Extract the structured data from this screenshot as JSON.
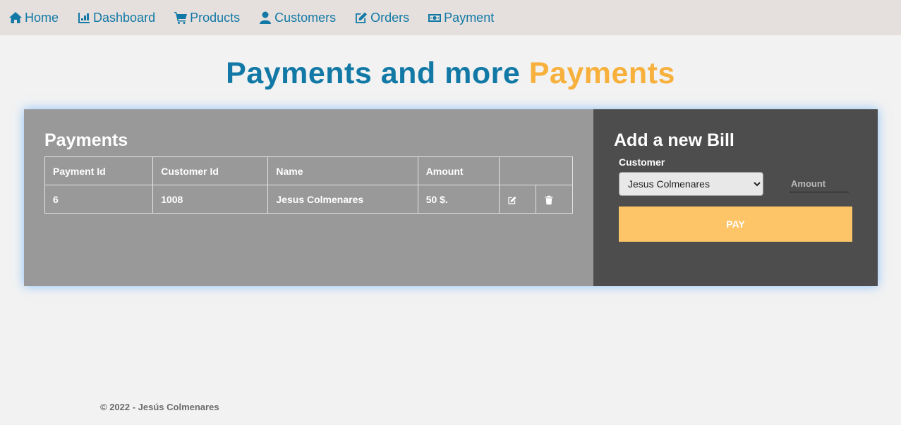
{
  "nav": {
    "items": [
      {
        "label": "Home",
        "icon": "home-icon"
      },
      {
        "label": "Dashboard",
        "icon": "chart-icon"
      },
      {
        "label": "Products",
        "icon": "cart-icon"
      },
      {
        "label": "Customers",
        "icon": "user-icon"
      },
      {
        "label": "Orders",
        "icon": "edit-icon"
      },
      {
        "label": "Payment",
        "icon": "money-icon"
      }
    ]
  },
  "page_title": {
    "part1": "Payments and more",
    "part2": "Payments"
  },
  "payments": {
    "title": "Payments",
    "columns": [
      "Payment Id",
      "Customer Id",
      "Name",
      "Amount"
    ],
    "rows": [
      {
        "payment_id": "6",
        "customer_id": "1008",
        "name": "Jesus Colmenares",
        "amount": "50 $."
      }
    ]
  },
  "new_bill": {
    "title": "Add a new Bill",
    "customer_label": "Customer",
    "customer_selected": "Jesus Colmenares",
    "amount_placeholder": "Amount",
    "pay_label": "PAY"
  },
  "footer": {
    "text": "© 2022 - Jesús Colmenares"
  },
  "colors": {
    "accent_blue": "#1279a6",
    "accent_orange": "#f7b03c",
    "pay_button": "#fdc468"
  }
}
